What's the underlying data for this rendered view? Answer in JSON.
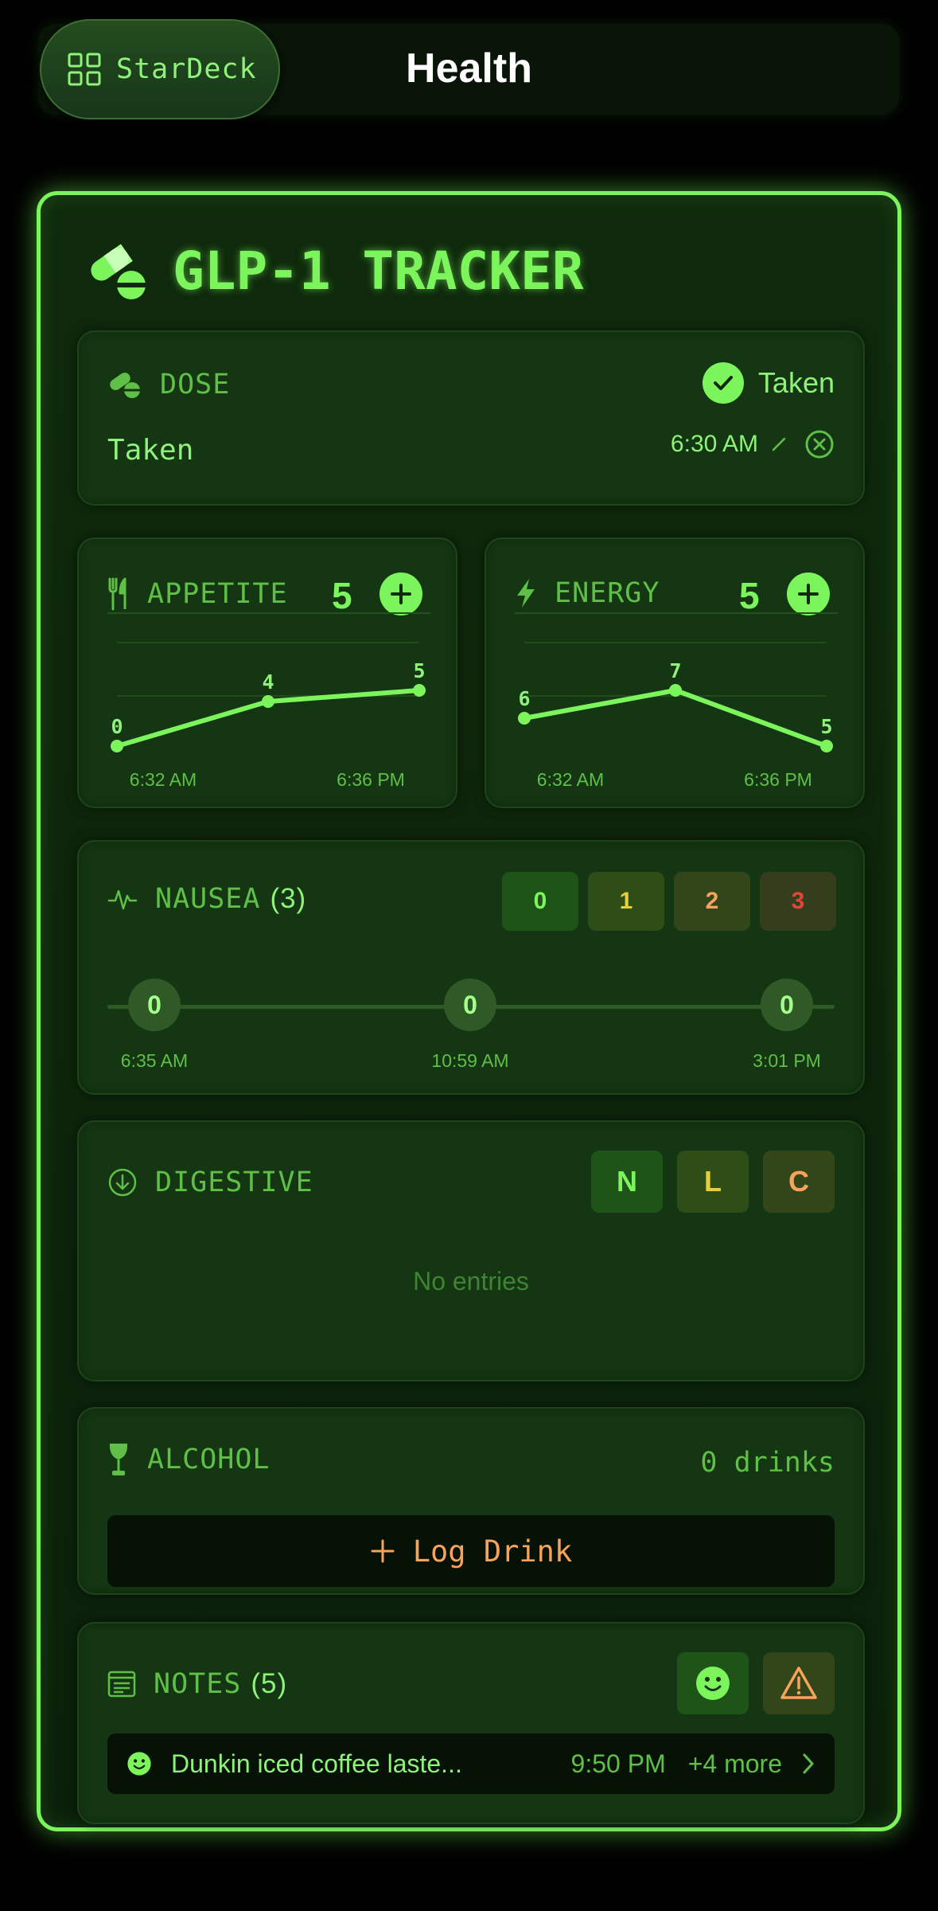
{
  "app": {
    "badge": "StarDeck",
    "title": "Health"
  },
  "tracker": {
    "title": "GLP-1 TRACKER"
  },
  "dose": {
    "label": "DOSE",
    "status": "Taken",
    "value": "Taken",
    "time": "6:30 AM"
  },
  "appetite": {
    "label": "APPETITE",
    "value": "5",
    "chart_data": {
      "type": "line",
      "x": [
        "6:32 AM",
        "",
        "6:36 PM"
      ],
      "values": [
        0,
        4,
        5
      ],
      "xlabel": "",
      "ylabel": ""
    }
  },
  "energy": {
    "label": "ENERGY",
    "value": "5",
    "chart_data": {
      "type": "line",
      "x": [
        "6:32 AM",
        "",
        "6:36 PM"
      ],
      "values": [
        6,
        7,
        5
      ],
      "xlabel": "",
      "ylabel": ""
    }
  },
  "nausea": {
    "label": "NAUSEA",
    "count": "(3)",
    "levels": [
      "0",
      "1",
      "2",
      "3"
    ],
    "entries": [
      {
        "value": "0",
        "time": "6:35 AM"
      },
      {
        "value": "0",
        "time": "10:59 AM"
      },
      {
        "value": "0",
        "time": "3:01 PM"
      }
    ]
  },
  "digestive": {
    "label": "DIGESTIVE",
    "options": [
      "N",
      "L",
      "C"
    ],
    "empty": "No entries"
  },
  "alcohol": {
    "label": "ALCOHOL",
    "count": "0 drinks",
    "button": "Log Drink"
  },
  "notes": {
    "label": "NOTES",
    "count": "(5)",
    "latest": {
      "text": "Dunkin iced coffee laste...",
      "time": "9:50 PM",
      "more": "+4 more"
    }
  },
  "colors": {
    "accent": "#7cf55c",
    "background": "#000000",
    "panel": "#143612",
    "warning": "#f7a35c",
    "danger": "#e0473a",
    "yellow": "#e6cf3a"
  }
}
